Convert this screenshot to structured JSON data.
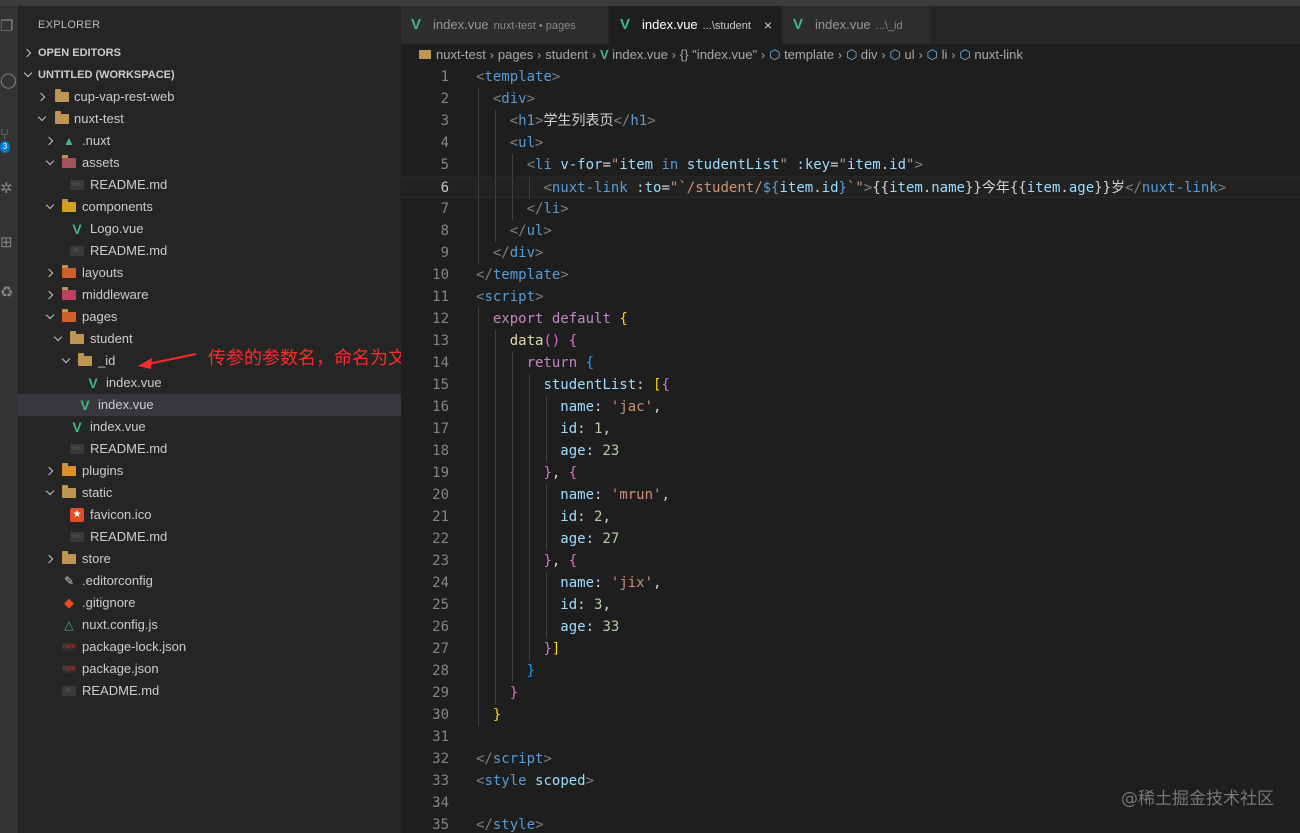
{
  "sidebar": {
    "title": "EXPLORER",
    "open_editors": "OPEN EDITORS",
    "workspace": "UNTITLED (WORKSPACE)",
    "tree": [
      {
        "label": "cup-vap-rest-web",
        "icon": "folder-icon"
      },
      {
        "label": "nuxt-test",
        "icon": "folder-open-icon"
      },
      {
        "label": ".nuxt",
        "icon": "nuxt-folder-icon"
      },
      {
        "label": "assets",
        "icon": "folder-open-icon"
      },
      {
        "label": "README.md",
        "icon": "markdown-icon"
      },
      {
        "label": "components",
        "icon": "folder-open-icon"
      },
      {
        "label": "Logo.vue",
        "icon": "vue-icon"
      },
      {
        "label": "README.md",
        "icon": "markdown-icon"
      },
      {
        "label": "layouts",
        "icon": "folder-icon"
      },
      {
        "label": "middleware",
        "icon": "folder-icon"
      },
      {
        "label": "pages",
        "icon": "folder-open-icon"
      },
      {
        "label": "student",
        "icon": "folder-open-icon"
      },
      {
        "label": "_id",
        "icon": "folder-open-icon"
      },
      {
        "label": "index.vue",
        "icon": "vue-icon"
      },
      {
        "label": "index.vue",
        "icon": "vue-icon"
      },
      {
        "label": "index.vue",
        "icon": "vue-icon"
      },
      {
        "label": "README.md",
        "icon": "markdown-icon"
      },
      {
        "label": "plugins",
        "icon": "folder-icon"
      },
      {
        "label": "static",
        "icon": "folder-open-icon"
      },
      {
        "label": "favicon.ico",
        "icon": "star-icon"
      },
      {
        "label": "README.md",
        "icon": "markdown-icon"
      },
      {
        "label": "store",
        "icon": "folder-icon"
      },
      {
        "label": ".editorconfig",
        "icon": "editorconfig-icon"
      },
      {
        "label": ".gitignore",
        "icon": "git-icon"
      },
      {
        "label": "nuxt.config.js",
        "icon": "nuxt-icon"
      },
      {
        "label": "package-lock.json",
        "icon": "npm-icon"
      },
      {
        "label": "package.json",
        "icon": "npm-icon"
      },
      {
        "label": "README.md",
        "icon": "markdown-icon"
      }
    ]
  },
  "activity_badge": "3",
  "annotation": "传参的参数名，命名为文件夹名称",
  "tabs": [
    {
      "name": "index.vue",
      "desc": "nuxt-test • pages"
    },
    {
      "name": "index.vue",
      "desc": "...\\student",
      "close": "×"
    },
    {
      "name": "index.vue",
      "desc": "...\\_id"
    }
  ],
  "breadcrumb": [
    "nuxt-test",
    "pages",
    "student",
    "index.vue",
    "{} \"index.vue\"",
    "template",
    "div",
    "ul",
    "li",
    "nuxt-link"
  ],
  "code_lines": [
    "1",
    "2",
    "3",
    "4",
    "5",
    "6",
    "7",
    "8",
    "9",
    "10",
    "11",
    "12",
    "13",
    "14",
    "15",
    "16",
    "17",
    "18",
    "19",
    "20",
    "21",
    "22",
    "23",
    "24",
    "25",
    "26",
    "27",
    "28",
    "29",
    "30",
    "31",
    "32",
    "33",
    "34",
    "35"
  ],
  "code": {
    "h1_text": "学生列表页",
    "nuxt_link_text_a": "今年",
    "nuxt_link_text_b": "岁",
    "names": [
      "'jac'",
      "'mrun'",
      "'jix'"
    ],
    "ids": [
      "1",
      "2",
      "3"
    ],
    "ages": [
      "23",
      "27",
      "33"
    ]
  },
  "watermark": "@稀土掘金技术社区",
  "colors": {
    "accent": "#007acc",
    "annotation": "#ff2a2a",
    "vue": "#41b883"
  }
}
